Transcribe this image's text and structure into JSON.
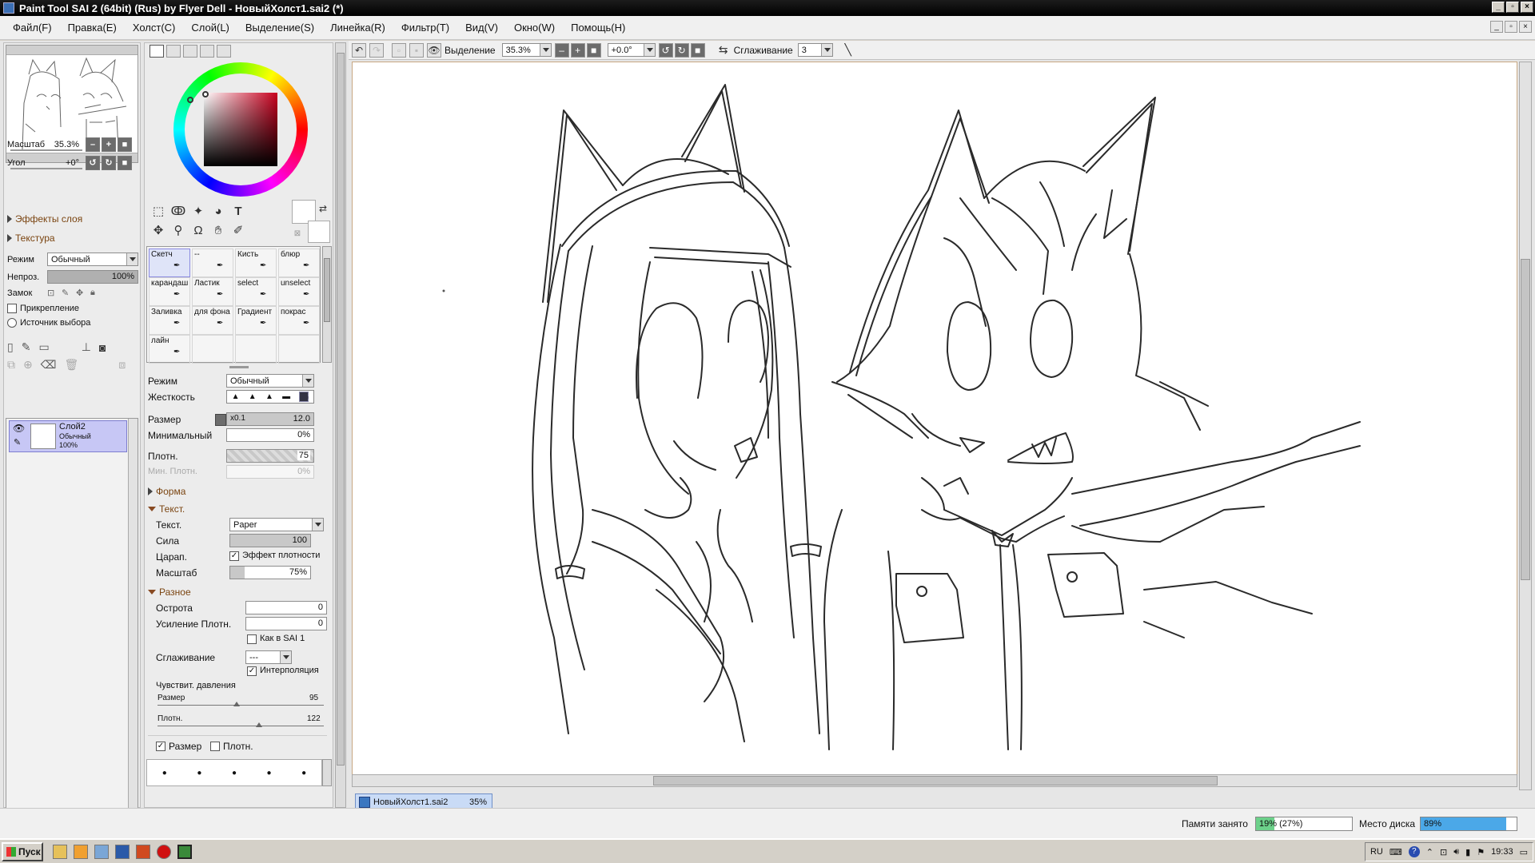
{
  "window": {
    "title": "Paint Tool SAI 2 (64bit) (Rus) by Flyer Dell - НовыйХолст1.sai2 (*)",
    "controls": [
      "_",
      "▫",
      "×"
    ]
  },
  "menu": [
    {
      "label": "Файл(F)"
    },
    {
      "label": "Правка(E)"
    },
    {
      "label": "Холст(C)"
    },
    {
      "label": "Слой(L)"
    },
    {
      "label": "Выделение(S)"
    },
    {
      "label": "Линейка(R)"
    },
    {
      "label": "Фильтр(T)"
    },
    {
      "label": "Вид(V)"
    },
    {
      "label": "Окно(W)"
    },
    {
      "label": "Помощь(H)"
    }
  ],
  "navigator": {
    "zoom_label": "Масштаб",
    "zoom_value": "35.3%",
    "angle_label": "Угол",
    "angle_value": "+0°"
  },
  "layer_panel": {
    "effects_label": "Эффекты слоя",
    "texture_label": "Текстура",
    "mode_label": "Режим",
    "mode_value": "Обычный",
    "opacity_label": "Непроз.",
    "opacity_value": "100%",
    "opacity_fraction": 1.0,
    "lock_label": "Замок",
    "clip_label": "Прикрепление",
    "source_label": "Источник выбора",
    "layers": [
      {
        "name": "Слой2",
        "mode": "Обычный",
        "opacity": "100%"
      }
    ]
  },
  "brushes": [
    {
      "label": "Скетч",
      "selected": true
    },
    {
      "label": "--",
      "selected": false
    },
    {
      "label": "Кисть",
      "selected": false
    },
    {
      "label": "блюр",
      "selected": false
    },
    {
      "label": "карандаш",
      "selected": false
    },
    {
      "label": "Ластик",
      "selected": false
    },
    {
      "label": "select",
      "selected": false
    },
    {
      "label": "unselect",
      "selected": false
    },
    {
      "label": "Заливка",
      "selected": false
    },
    {
      "label": "для фона",
      "selected": false
    },
    {
      "label": "Градиент",
      "selected": false
    },
    {
      "label": "покрас",
      "selected": false
    },
    {
      "label": "лайн",
      "selected": false
    }
  ],
  "brush_settings": {
    "mode_label": "Режим",
    "mode_value": "Обычный",
    "hardness_label": "Жесткость",
    "size_label": "Размер",
    "size_mult": "x0.1",
    "size_value": "12.0",
    "min_label": "Минимальный",
    "min_value": "0%",
    "density_label": "Плотн.",
    "density_value": "75",
    "min_density_label": "Мин. Плотн.",
    "min_density_value": "0%",
    "shape_label": "Форма",
    "texture_section": "Текст.",
    "texture_label": "Текст.",
    "texture_value": "Paper",
    "strength_label": "Сила",
    "strength_value": "100",
    "scratch_label": "Царап.",
    "scratch_effect": "Эффект плотности",
    "scale_label": "Масштаб",
    "scale_value": "75%",
    "misc_section": "Разное",
    "sharpness_label": "Острота",
    "sharpness_value": "0",
    "density_boost_label": "Усиление Плотн.",
    "density_boost_value": "0",
    "as_sai1_label": "Как в SAI 1",
    "smoothing_label": "Сглаживание",
    "smoothing_value": "---",
    "interpolation_label": "Интерполяция",
    "pressure_label": "Чувствит. давления",
    "pressure_size_label": "Размер",
    "pressure_size_value": "95",
    "pressure_density_label": "Плотн.",
    "pressure_density_value": "122",
    "bottom_size_label": "Размер",
    "bottom_density_label": "Плотн."
  },
  "canvas_toolbar": {
    "selection_label": "Выделение",
    "zoom_value": "35.3%",
    "angle_value": "+0.0°",
    "smoothing_label": "Сглаживание",
    "smoothing_value": "3"
  },
  "doc_tab": {
    "name": "НовыйХолст1.sai2",
    "zoom": "35%"
  },
  "status": {
    "memory_label": "Памяти занято",
    "memory_value": "19% (27%)",
    "memory_fraction": 0.19,
    "disk_label": "Место диска",
    "disk_value": "89%",
    "disk_fraction": 0.89
  },
  "taskbar": {
    "start_label": "Пуск",
    "lang": "RU",
    "clock": "19:33"
  }
}
